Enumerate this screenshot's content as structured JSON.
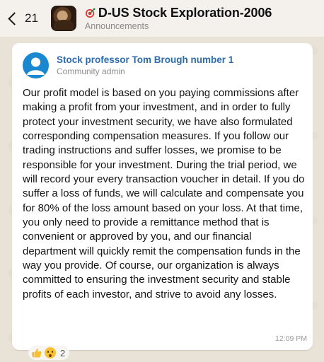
{
  "header": {
    "back_count": "21",
    "group_title": "D-US Stock Exploration-2006",
    "group_subtitle": "Announcements"
  },
  "message": {
    "sender_name": "Stock professor Tom Brough number 1",
    "sender_role": "Community admin",
    "text": "Our profit model is based on you paying commissions after making a profit from your investment, and in order to fully protect your investment security, we have also formulated corresponding compensation measures. If you follow our trading instructions and suffer losses, we promise to be responsible for your investment. During the trial period, we will record your every transaction voucher in detail. If you do suffer a loss of funds, we will calculate and compensate you for 80% of the loss amount based on your loss. At that time, you only need to provide a remittance method that is convenient or approved by you, and our financial department will quickly remit the compensation funds in the way you provide. Of course, our organization is always committed to ensuring the investment security and stable profits of each investor, and strive to avoid any losses.",
    "time": "12:09 PM"
  },
  "reactions": {
    "emojis": [
      "thumbs-up-icon",
      "astonished-face-icon"
    ],
    "count": "2"
  },
  "colors": {
    "sender_name": "#2b6cb0",
    "avatar_bg": "#1a88d1",
    "chat_bg": "#e9e2d6"
  }
}
